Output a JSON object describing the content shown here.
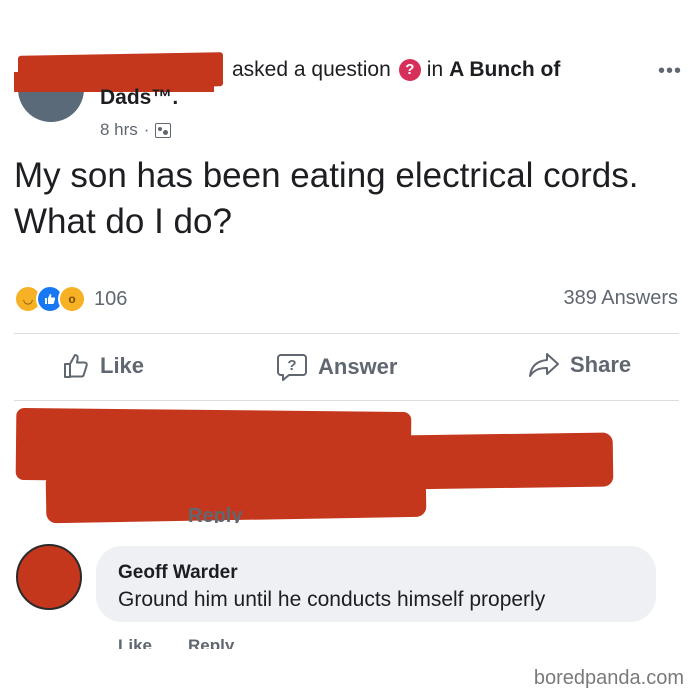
{
  "post": {
    "author_action": "asked a question",
    "group_prefix": "in",
    "group_name": "A Bunch of",
    "group_name_cont": "Dads™.",
    "time": "8 hrs",
    "separator": "·",
    "question": "My son has been eating electrical cords. What do I do?",
    "more_icon": "more-horizontal-icon"
  },
  "stats": {
    "reaction_count": "106",
    "answers_count": "389 Answers",
    "reactions": [
      "haha",
      "like",
      "wow"
    ]
  },
  "actions": {
    "like": "Like",
    "answer": "Answer",
    "share": "Share"
  },
  "comments": [
    {
      "author": "",
      "reply_label": "Reply",
      "redacted": true
    },
    {
      "author": "Geoff Warder",
      "text": "Ground him until he conducts himself properly",
      "like_label": "Like",
      "reply_label": "Reply"
    }
  ],
  "watermark": "boredpanda.com",
  "colors": {
    "redaction": "#c5371c",
    "question_badge": "#d6305a",
    "like_blue": "#1877f2",
    "secondary_text": "#606770",
    "bubble": "#eef0f3"
  }
}
